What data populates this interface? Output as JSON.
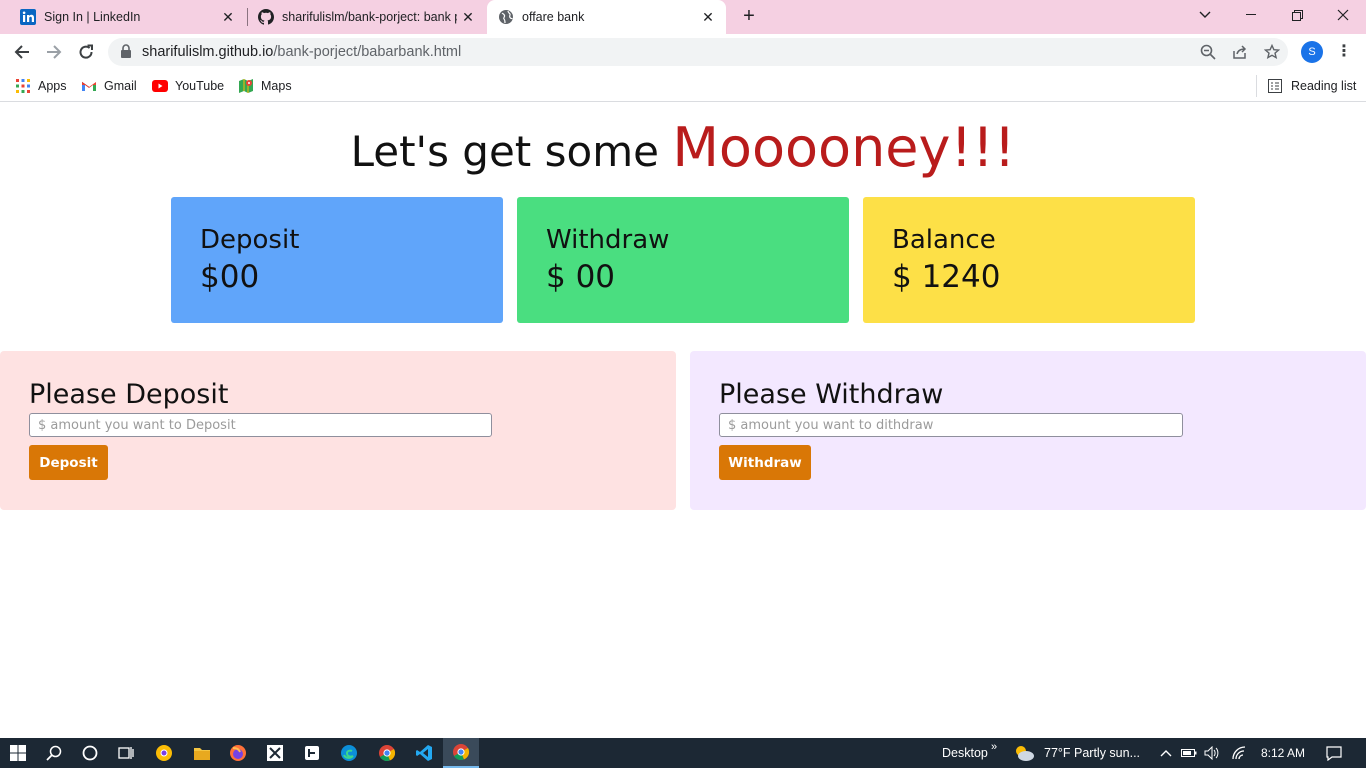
{
  "browser": {
    "tabs": [
      {
        "title": "Sign In | LinkedIn",
        "icon": "linkedin-icon"
      },
      {
        "title": "sharifulislm/bank-porject: bank p",
        "icon": "github-icon"
      },
      {
        "title": "offare bank",
        "icon": "globe-icon"
      }
    ],
    "new_tab_label": "+",
    "url_host": "sharifulislm.github.io",
    "url_path": "/bank-porject/babarbank.html",
    "profile_initial": "S",
    "bookmarks": [
      "Apps",
      "Gmail",
      "YouTube",
      "Maps"
    ],
    "reading_list": "Reading list"
  },
  "page": {
    "headline_prefix": "Let's get some",
    "headline_money": "Mooooney!!!",
    "cards": [
      {
        "title": "Deposit",
        "value": "$00",
        "color": "#60a5fa"
      },
      {
        "title": "Withdraw",
        "value": "$ 00",
        "color": "#4ade80"
      },
      {
        "title": "Balance",
        "value": "$ 1240",
        "color": "#fde047"
      }
    ],
    "deposit_panel": {
      "heading": "Please Deposit",
      "placeholder": "$ amount you want to Deposit",
      "button": "Deposit",
      "bg": "#fee2e2"
    },
    "withdraw_panel": {
      "heading": "Please Withdraw",
      "placeholder": "$ amount you want to dithdraw",
      "button": "Withdraw",
      "bg": "#f3e8ff"
    },
    "accent": "#d97706",
    "money_color": "#b91c1c"
  },
  "taskbar": {
    "desktop_label": "Desktop",
    "weather": "77°F  Partly sun...",
    "time": "8:12 AM"
  }
}
